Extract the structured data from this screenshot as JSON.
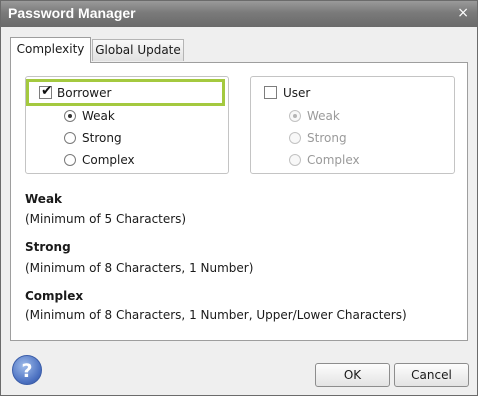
{
  "window": {
    "title": "Password Manager"
  },
  "tabs": [
    {
      "label": "Complexity"
    },
    {
      "label": "Global Update"
    }
  ],
  "borrower": {
    "label": "Borrower",
    "checked": true,
    "options": [
      "Weak",
      "Strong",
      "Complex"
    ],
    "selected": "Weak"
  },
  "user": {
    "label": "User",
    "checked": false,
    "options": [
      "Weak",
      "Strong",
      "Complex"
    ],
    "selected": "Weak",
    "disabled": true
  },
  "descriptions": [
    {
      "name": "Weak",
      "text": "(Minimum of 5 Characters)"
    },
    {
      "name": "Strong",
      "text": "(Minimum of 8 Characters, 1 Number)"
    },
    {
      "name": "Complex",
      "text": "(Minimum of 8 Characters, 1 Number, Upper/Lower Characters)"
    }
  ],
  "buttons": {
    "help": "?",
    "ok": "OK",
    "cancel": "Cancel"
  },
  "icons": {
    "close": "×",
    "check": "✔"
  },
  "colors": {
    "highlight": "#a4c93f",
    "titlebar": "#7a7a7a"
  }
}
